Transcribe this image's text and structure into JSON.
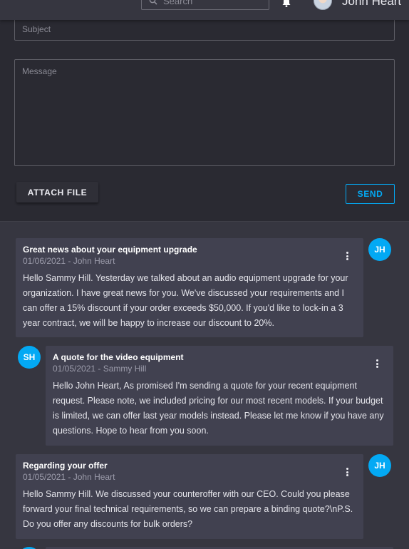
{
  "header": {
    "search_placeholder": "Search",
    "user_name": "John Heart",
    "search_icon": "search-icon",
    "bell_icon": "bell-icon"
  },
  "compose": {
    "subject_placeholder": "Subject",
    "message_placeholder": "Message",
    "attach_label": "ATTACH FILE",
    "send_label": "SEND"
  },
  "messages": [
    {
      "title": "Great news about your equipment upgrade",
      "meta": "01/06/2021 - John Heart",
      "body": "Hello Sammy Hill. Yesterday we talked about an audio equipment upgrade for your organization. I have great news for you. We've discussed your requirements and I can offer a 15% discount if your order exceeds $50,000. If you'd like to lock-in a 3 year contract, we will be happy to increase our discount to 20%.",
      "initials": "JH"
    },
    {
      "title": "A quote for the video equipment",
      "meta": "01/05/2021 - Sammy Hill",
      "body": "Hello John Heart, As promised I'm sending a quote for your recent equipment request. Please note, we included pricing for our most recent models. If your budget is limited, we can offer last year models instead. Please let me know if you have any questions. Hope to hear from you soon.",
      "initials": "SH"
    },
    {
      "title": "Regarding your offer",
      "meta": "01/05/2021 - John Heart",
      "body": "Hello Sammy Hill. We discussed your counteroffer with our CEO. Could you please forward your final technical requirements, so we can prepare a binding quote?\\nP.S. Do you offer any discounts for bulk orders?",
      "initials": "JH"
    }
  ],
  "colors": {
    "accent": "#03a9f4",
    "panel": "#2a2a32",
    "card": "#414150",
    "background": "#363640"
  }
}
